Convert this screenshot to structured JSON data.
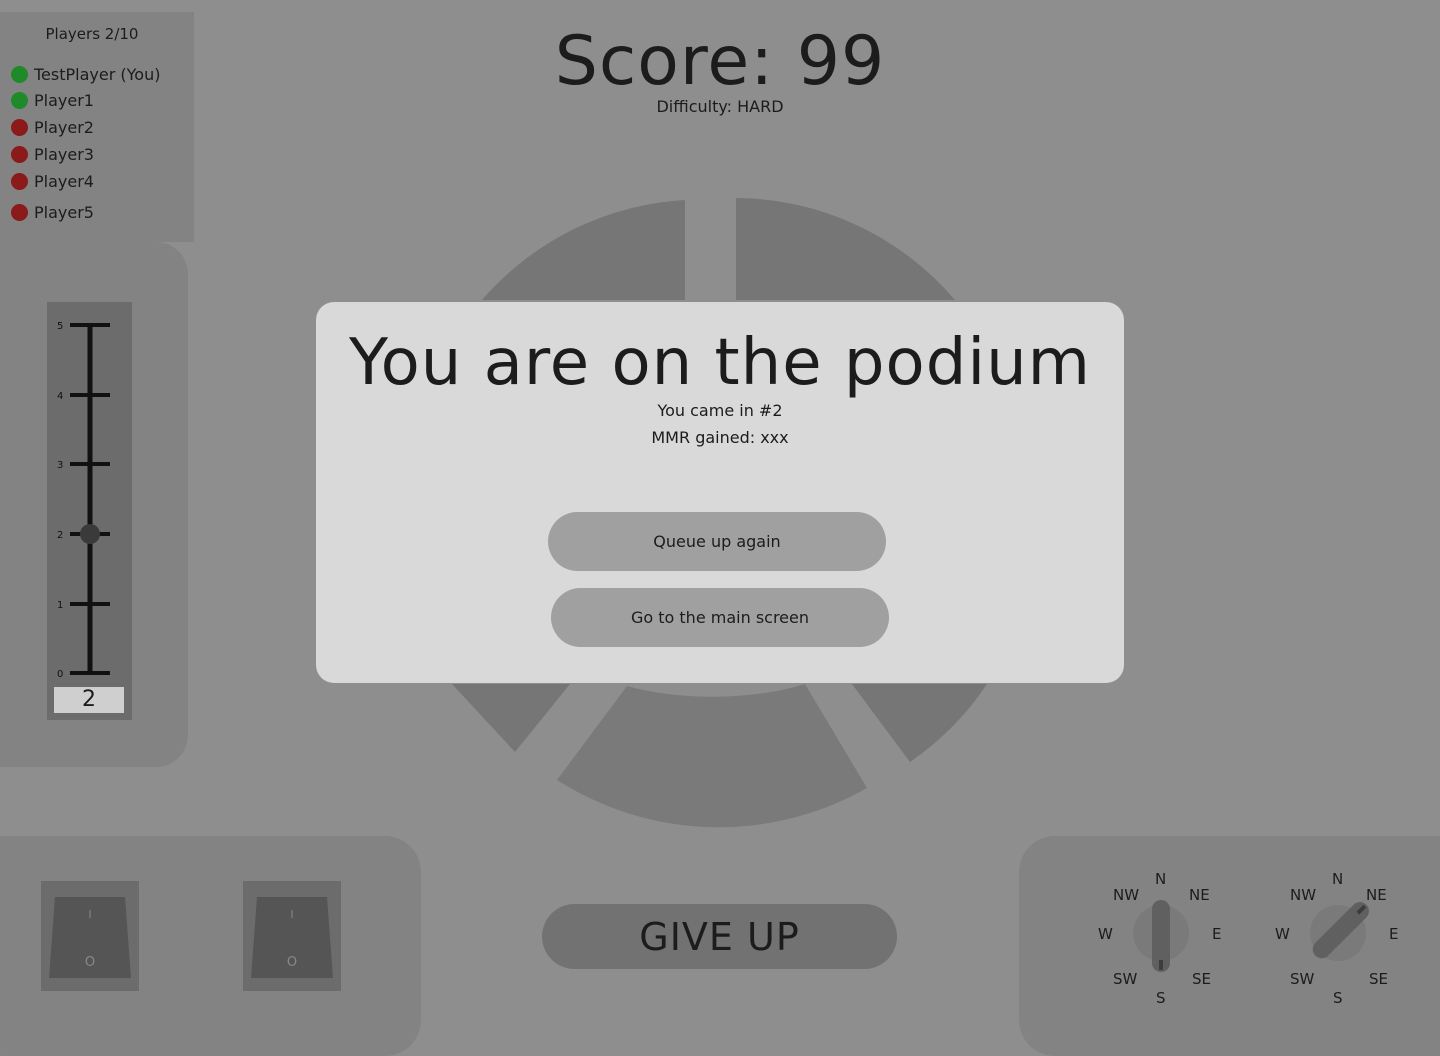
{
  "players": {
    "title": "Players 2/10",
    "list": [
      {
        "name": "TestPlayer (You)",
        "status": "green"
      },
      {
        "name": "Player1",
        "status": "green"
      },
      {
        "name": "Player2",
        "status": "red"
      },
      {
        "name": "Player3",
        "status": "red"
      },
      {
        "name": "Player4",
        "status": "red"
      },
      {
        "name": "Player5",
        "status": "red"
      }
    ]
  },
  "header": {
    "score": "Score: 99",
    "difficulty": "Difficulty: HARD"
  },
  "slider": {
    "ticks": [
      "5",
      "4",
      "3",
      "2",
      "1",
      "0"
    ],
    "value": "2"
  },
  "switches": {
    "on_label": "I",
    "off_label": "O"
  },
  "give_up": "GIVE UP",
  "compass": {
    "labels": [
      "N",
      "NE",
      "E",
      "SE",
      "S",
      "SW",
      "W",
      "NW"
    ],
    "dial_1_direction": "S",
    "dial_2_direction": "NE"
  },
  "modal": {
    "title": "You are on the podium",
    "place": "You came in #2",
    "mmr": "MMR gained: xxx",
    "queue_button": "Queue up again",
    "main_button": "Go to the main screen"
  },
  "colors": {
    "online": "#1f8a2a",
    "offline": "#8b1a1a"
  }
}
